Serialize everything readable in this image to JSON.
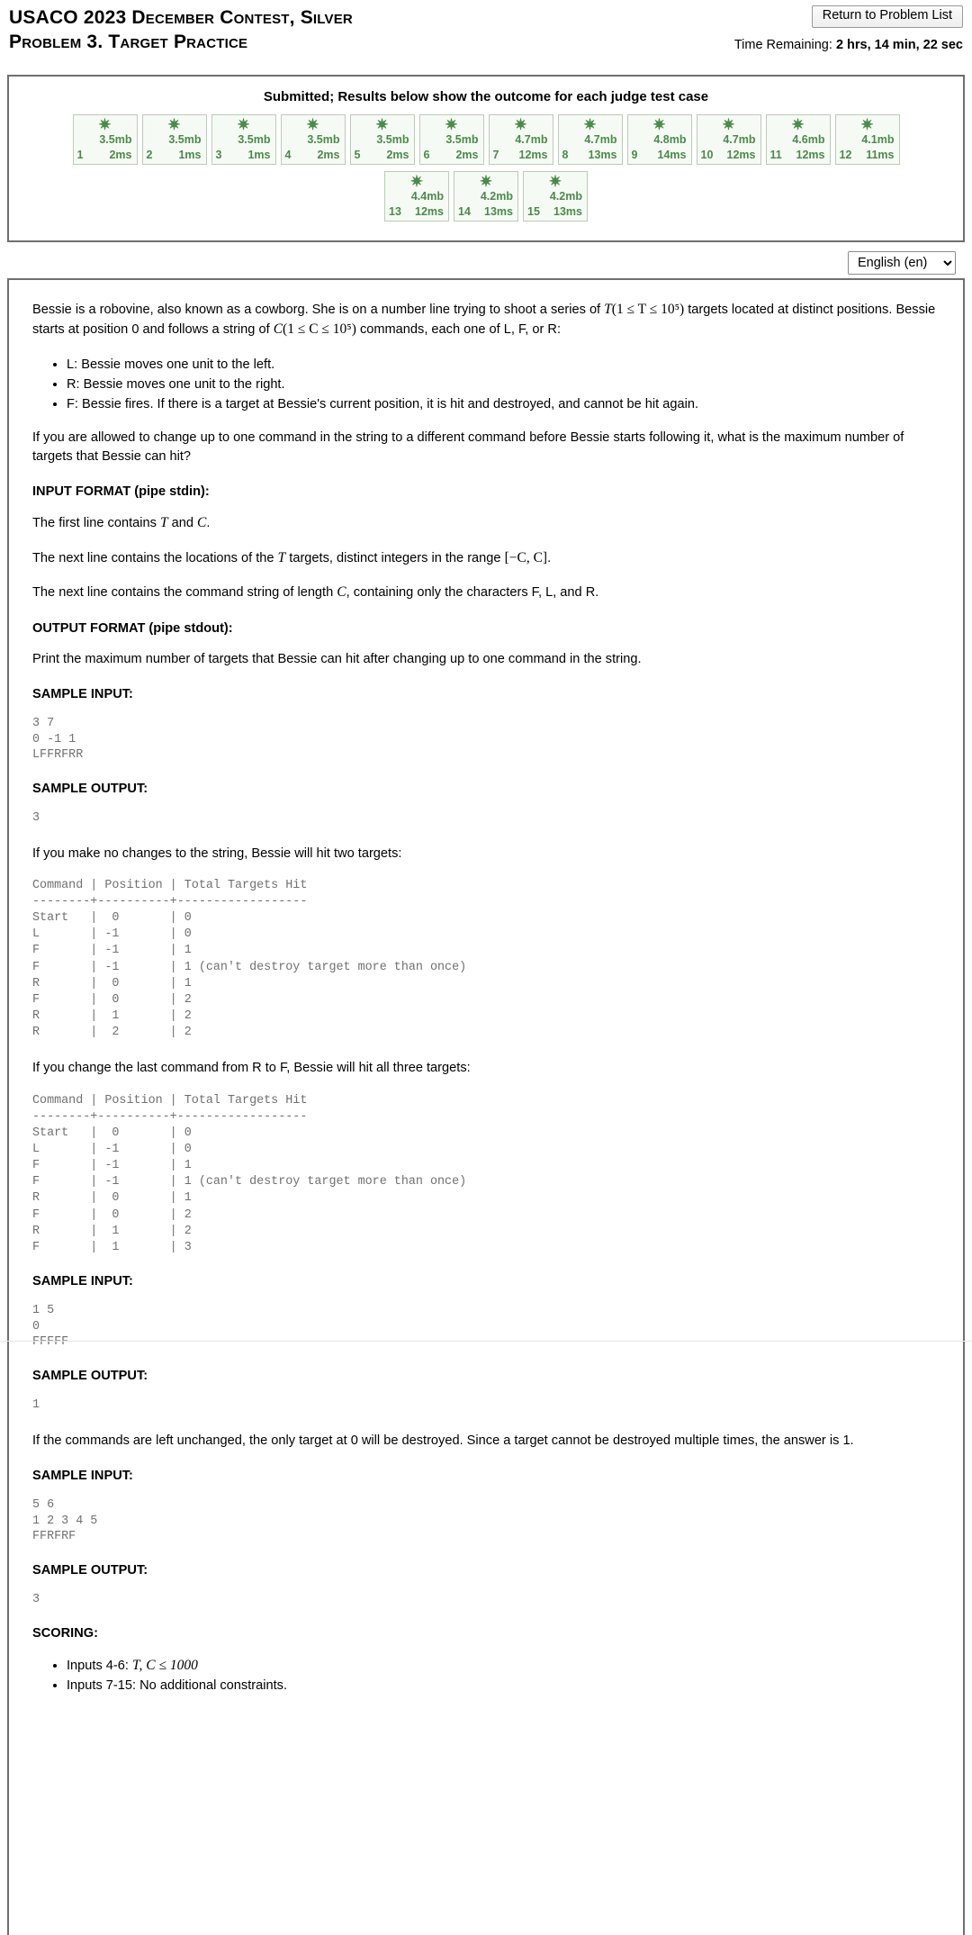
{
  "header": {
    "contest_title": "USACO 2023 December Contest, Silver",
    "problem_title": "Problem 3. Target Practice",
    "return_button": "Return to Problem List",
    "time_remaining_label": "Time Remaining:",
    "time_remaining_value": "2 hrs, 14 min, 22 sec"
  },
  "results": {
    "status": "Submitted; Results below show the outcome for each judge test case",
    "pass_glyph": "✷",
    "pass_color": "#4c8a4c",
    "cases": [
      {
        "num": "1",
        "mem": "3.5mb",
        "time": "2ms"
      },
      {
        "num": "2",
        "mem": "3.5mb",
        "time": "1ms"
      },
      {
        "num": "3",
        "mem": "3.5mb",
        "time": "1ms"
      },
      {
        "num": "4",
        "mem": "3.5mb",
        "time": "2ms"
      },
      {
        "num": "5",
        "mem": "3.5mb",
        "time": "2ms"
      },
      {
        "num": "6",
        "mem": "3.5mb",
        "time": "2ms"
      },
      {
        "num": "7",
        "mem": "4.7mb",
        "time": "12ms"
      },
      {
        "num": "8",
        "mem": "4.7mb",
        "time": "13ms"
      },
      {
        "num": "9",
        "mem": "4.8mb",
        "time": "14ms"
      },
      {
        "num": "10",
        "mem": "4.7mb",
        "time": "12ms"
      },
      {
        "num": "11",
        "mem": "4.6mb",
        "time": "12ms"
      },
      {
        "num": "12",
        "mem": "4.1mb",
        "time": "11ms"
      },
      {
        "num": "13",
        "mem": "4.4mb",
        "time": "12ms"
      },
      {
        "num": "14",
        "mem": "4.2mb",
        "time": "13ms"
      },
      {
        "num": "15",
        "mem": "4.2mb",
        "time": "13ms"
      }
    ]
  },
  "language": {
    "selected": "English (en)",
    "options": [
      "English (en)"
    ]
  },
  "statement": {
    "intro_1": "Bessie is a robovine, also known as a cowborg. She is on a number line trying to shoot a series of ",
    "intro_T": "T",
    "intro_T_range": "(1 ≤ T ≤ 10⁵)",
    "intro_2": " targets located at distinct positions. Bessie starts at position 0 and follows a string of ",
    "intro_C": "C",
    "intro_C_range": "(1 ≤ C ≤ 10⁵)",
    "intro_3": " commands, each one of L, F, or R:",
    "commands": [
      "L: Bessie moves one unit to the left.",
      "R: Bessie moves one unit to the right.",
      "F: Bessie fires. If there is a target at Bessie's current position, it is hit and destroyed, and cannot be hit again."
    ],
    "question": "If you are allowed to change up to one command in the string to a different command before Bessie starts following it, what is the maximum number of targets that Bessie can hit?",
    "input_format_heading": "INPUT FORMAT (pipe stdin):",
    "input_line_1_a": "The first line contains ",
    "input_line_1_T": "T",
    "input_line_1_b": " and ",
    "input_line_1_C": "C",
    "input_line_1_c": ".",
    "input_line_2_a": "The next line contains the locations of the ",
    "input_line_2_T": "T",
    "input_line_2_b": " targets, distinct integers in the range ",
    "input_line_2_range": "[−C, C]",
    "input_line_2_c": ".",
    "input_line_3_a": "The next line contains the command string of length ",
    "input_line_3_C": "C",
    "input_line_3_b": ", containing only the characters F, L, and R.",
    "output_format_heading": "OUTPUT FORMAT (pipe stdout):",
    "output_desc": "Print the maximum number of targets that Bessie can hit after changing up to one command in the string.",
    "sample_input_heading": "SAMPLE INPUT:",
    "sample_output_heading": "SAMPLE OUTPUT:",
    "sample_1_input": "3 7\n0 -1 1\nLFFRFRR",
    "sample_1_output": "3",
    "explain_1": "If you make no changes to the string, Bessie will hit two targets:",
    "trace_1": "Command | Position | Total Targets Hit\n--------+----------+------------------\nStart   |  0       | 0\nL       | -1       | 0\nF       | -1       | 1\nF       | -1       | 1 (can't destroy target more than once)\nR       |  0       | 1\nF       |  0       | 2\nR       |  1       | 2\nR       |  2       | 2",
    "explain_2": "If you change the last command from R to F, Bessie will hit all three targets:",
    "trace_2": "Command | Position | Total Targets Hit\n--------+----------+------------------\nStart   |  0       | 0\nL       | -1       | 0\nF       | -1       | 1\nF       | -1       | 1 (can't destroy target more than once)\nR       |  0       | 1\nF       |  0       | 2\nR       |  1       | 2\nF       |  1       | 3",
    "sample_2_input": "1 5\n0\nFFFFF",
    "sample_2_output": "1",
    "explain_3": "If the commands are left unchanged, the only target at 0 will be destroyed. Since a target cannot be destroyed multiple times, the answer is 1.",
    "sample_3_input": "5 6\n1 2 3 4 5\nFFRFRF",
    "sample_3_output": "3",
    "scoring_heading": "SCORING:",
    "scoring_items": [
      {
        "prefix": "Inputs 4-6: ",
        "math": "T, C ≤ 1000",
        "suffix": ""
      },
      {
        "prefix": "Inputs 7-15: No additional constraints.",
        "math": "",
        "suffix": ""
      }
    ]
  }
}
